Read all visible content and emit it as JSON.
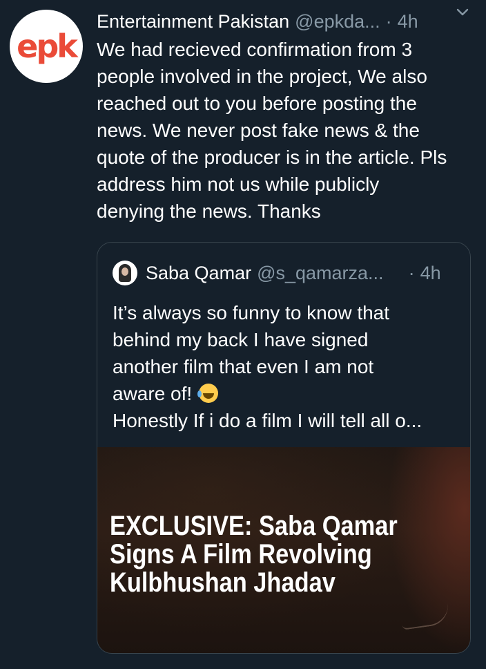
{
  "tweet": {
    "author_name": "Entertainment Pakistan",
    "author_handle": "@epkda...",
    "separator": "·",
    "time": "4h",
    "avatar_text": "epk",
    "text": "We had recieved confirmation from 3\npeople involved in the project, We also\nreached out to you before posting the\nnews. We never post fake news & the\nquote of the producer is in the article. Pls\naddress him not us while publicly\ndenying the news. Thanks"
  },
  "quote": {
    "author_name": "Saba Qamar",
    "author_handle": "@s_qamarza...",
    "separator": "·",
    "time": "4h",
    "lines": [
      "It’s always so funny to know that",
      "behind my back I have signed",
      "another film that even I am not",
      "aware of!",
      "Honestly If i do a film I will tell all o..."
    ],
    "emoji": "face-with-tears-of-joy-icon",
    "image_headline": [
      "EXCLUSIVE: Saba Qamar",
      "Signs A Film Revolving",
      "Kulbhushan Jhadav"
    ]
  },
  "colors": {
    "background": "#15202b",
    "secondary_text": "#8899a6",
    "border": "#38444d",
    "logo": "#ea4b38"
  }
}
